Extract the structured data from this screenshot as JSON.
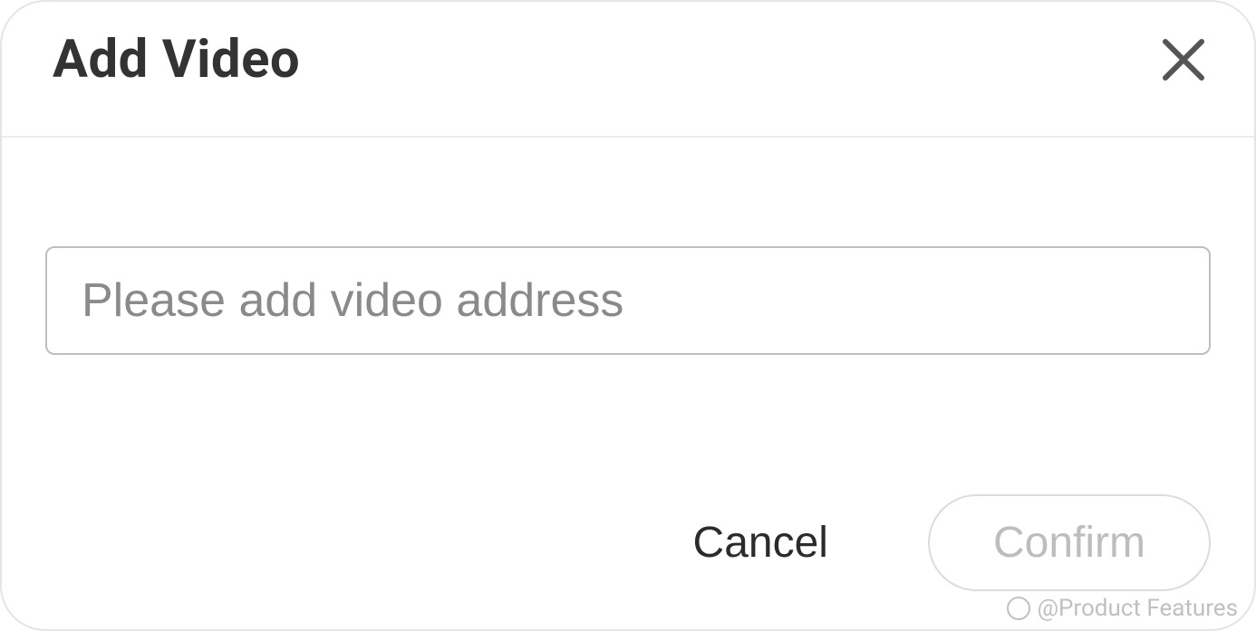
{
  "dialog": {
    "title": "Add Video",
    "input": {
      "value": "",
      "placeholder": "Please add video address"
    },
    "buttons": {
      "cancel": "Cancel",
      "confirm": "Confirm"
    }
  },
  "watermark": {
    "text": "@Product Features"
  }
}
